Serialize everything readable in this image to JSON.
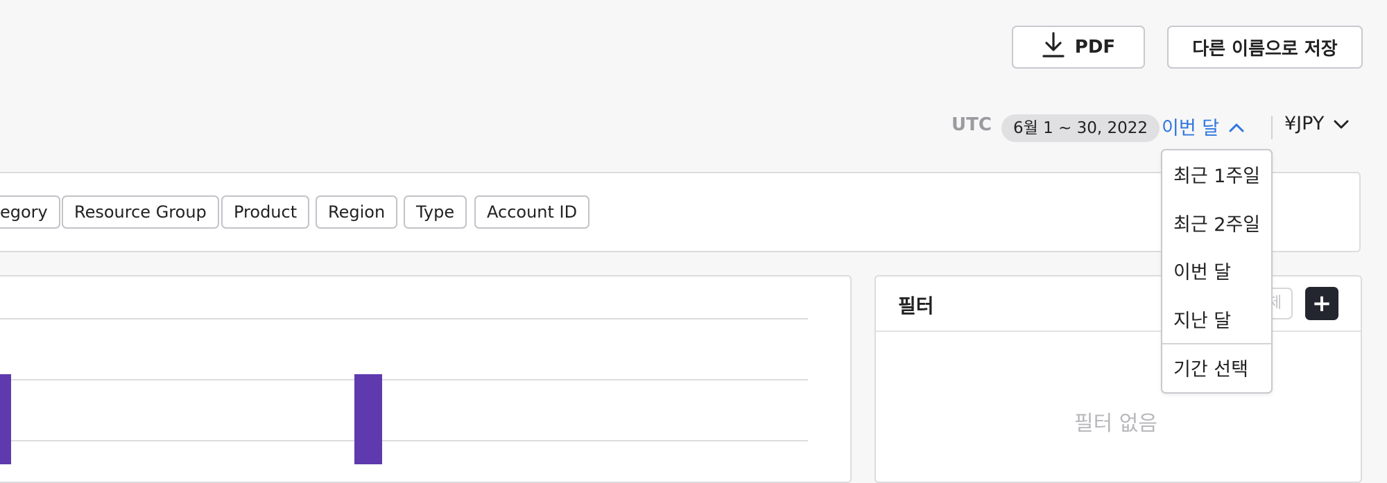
{
  "toolbar": {
    "pdf_label": "PDF",
    "save_as_label": "다른 이름으로 저장"
  },
  "date_range": {
    "timezone": "UTC",
    "range": "6월 1 ~ 30, 2022",
    "period_label": "이번 달",
    "currency": "¥JPY"
  },
  "period_menu": {
    "items": [
      "최근 1주일",
      "최근 2주일",
      "이번 달",
      "지난 달"
    ],
    "custom": "기간 선택"
  },
  "group_by_tags": [
    "Category",
    "Resource Group",
    "Product",
    "Region",
    "Type",
    "Account ID"
  ],
  "tag_partial_label": "egory",
  "filter_panel": {
    "title": "필터",
    "clear_partial": "제",
    "add_label": "+",
    "empty_text": "필터 없음"
  },
  "colors": {
    "accent_blue": "#2f76e0",
    "bar_purple": "#5e3aae",
    "dark_button": "#23262f"
  },
  "chart_data": {
    "type": "bar",
    "series": [
      {
        "values": [
          1,
          1
        ]
      }
    ],
    "gridlines": true
  }
}
